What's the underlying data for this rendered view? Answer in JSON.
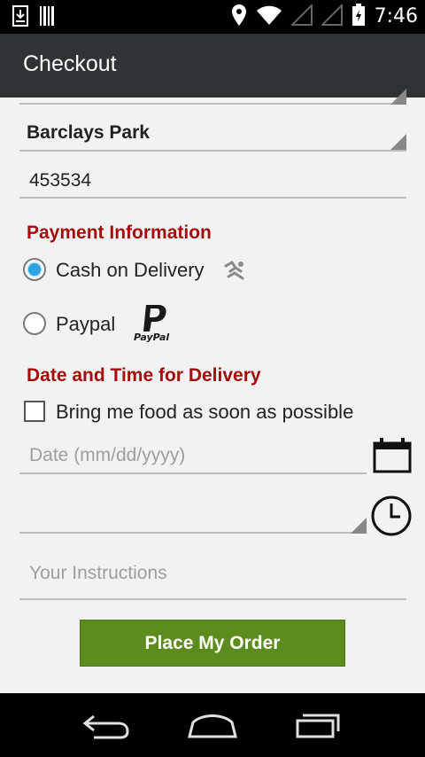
{
  "status_bar": {
    "time": "7:46",
    "icons": [
      "download-icon",
      "barcode-icon",
      "location-icon",
      "wifi-icon",
      "signal-icon",
      "signal-icon-2",
      "battery-icon"
    ]
  },
  "action_bar": {
    "title": "Checkout"
  },
  "form": {
    "area_value": "Barclays Park",
    "zip_value": "453534",
    "payment_title": "Payment Information",
    "payment_options": [
      {
        "label": "Cash on Delivery",
        "selected": true,
        "icon": "cash-delivery-icon"
      },
      {
        "label": "Paypal",
        "selected": false,
        "icon": "paypal-logo"
      }
    ],
    "paypal_logo_text": "PayPal",
    "delivery_title": "Date and Time for Delivery",
    "asap_label": "Bring me food as soon as possible",
    "asap_checked": false,
    "date_placeholder": "Date (mm/dd/yyyy)",
    "time_value": "",
    "instructions_placeholder": "Your Instructions"
  },
  "actions": {
    "place_order_label": "Place My Order"
  },
  "colors": {
    "accent_red": "#a50d0d",
    "button_green": "#5c8c1e",
    "radio_blue": "#2aa3e3",
    "action_bar": "#2e3336"
  },
  "nav_bar": {
    "icons": [
      "back-icon",
      "home-icon",
      "recents-icon"
    ]
  }
}
